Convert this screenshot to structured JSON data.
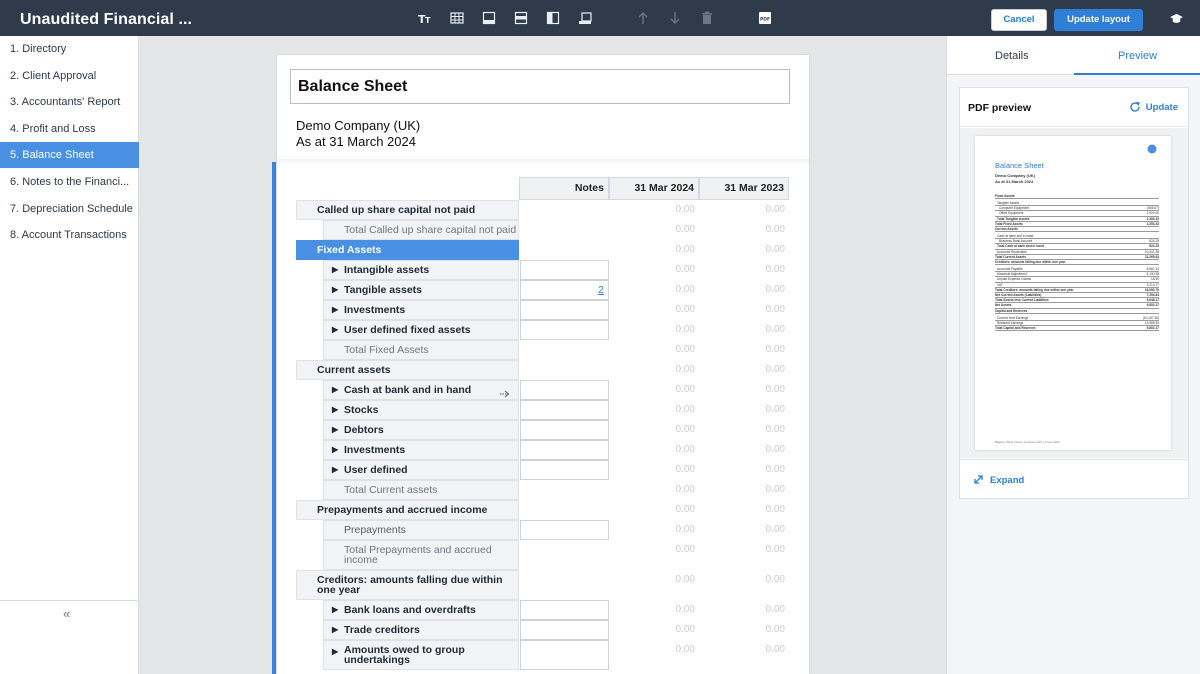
{
  "header": {
    "title": "Unaudited Financial ...",
    "cancel_label": "Cancel",
    "update_label": "Update layout"
  },
  "sidebar": {
    "items": [
      {
        "label": "1. Directory"
      },
      {
        "label": "2. Client Approval"
      },
      {
        "label": "3. Accountants' Report"
      },
      {
        "label": "4. Profit and Loss"
      },
      {
        "label": "5. Balance Sheet",
        "active": true
      },
      {
        "label": "6. Notes to the Financi..."
      },
      {
        "label": "7. Depreciation Schedule"
      },
      {
        "label": "8. Account Transactions"
      }
    ],
    "collapse_glyph": "«"
  },
  "document": {
    "title": "Balance Sheet",
    "company": "Demo Company (UK)",
    "as_at": "As at 31 March 2024",
    "columns": [
      "Notes",
      "31 Mar 2024",
      "31 Mar 2023"
    ],
    "zero": "0.00",
    "rows": [
      {
        "kind": "sec",
        "label": "Called up share capital not paid"
      },
      {
        "kind": "tot",
        "label": "Total Called up share capital not paid"
      },
      {
        "kind": "sec",
        "label": "Fixed Assets",
        "active": true
      },
      {
        "kind": "sub",
        "label": "Intangible assets",
        "notes": true
      },
      {
        "kind": "sub",
        "label": "Tangible assets",
        "notes": true,
        "note": "2"
      },
      {
        "kind": "sub",
        "label": "Investments",
        "notes": true
      },
      {
        "kind": "sub",
        "label": "User defined fixed assets",
        "notes": true
      },
      {
        "kind": "tot",
        "label": "Total Fixed Assets"
      },
      {
        "kind": "sec",
        "label": "Current assets"
      },
      {
        "kind": "sub",
        "label": "Cash at bank and in hand",
        "notes": true,
        "arrow": true
      },
      {
        "kind": "sub",
        "label": "Stocks",
        "notes": true
      },
      {
        "kind": "sub",
        "label": "Debtors",
        "notes": true
      },
      {
        "kind": "sub",
        "label": "Investments",
        "notes": true
      },
      {
        "kind": "sub",
        "label": "User defined",
        "notes": true
      },
      {
        "kind": "tot",
        "label": "Total Current assets"
      },
      {
        "kind": "sec",
        "label": "Prepayments and accrued income"
      },
      {
        "kind": "plain",
        "label": "Prepayments",
        "notes": true
      },
      {
        "kind": "tot2",
        "label": "Total Prepayments and accrued income"
      },
      {
        "kind": "sec2",
        "label": "Creditors: amounts falling due within one year"
      },
      {
        "kind": "sub",
        "label": "Bank loans and overdrafts",
        "notes": true
      },
      {
        "kind": "sub",
        "label": "Trade creditors",
        "notes": true
      },
      {
        "kind": "sub2",
        "label": "Amounts owed to group undertakings",
        "notes": true
      }
    ]
  },
  "right_panel": {
    "tabs": [
      "Details",
      "Preview"
    ],
    "preview_title": "PDF preview",
    "update_label": "Update",
    "expand_label": "Expand",
    "mini_page": {
      "title": "Balance Sheet",
      "company": "Demo Company (UK)",
      "as_at": "As at 31 March 2024",
      "lines": [
        {
          "t": "Fixed Assets",
          "b": true
        },
        {
          "t": "Tangible Assets",
          "b": false,
          "i": 1
        },
        {
          "t": "Computer Equipment",
          "v": "(565.67)",
          "i": 2
        },
        {
          "t": "Office Equipment",
          "v": "2,920.00",
          "i": 2
        },
        {
          "t": "Total Tangible Assets",
          "v": "2,353.33",
          "i": 1,
          "b": true
        },
        {
          "t": "Total Fixed Assets",
          "v": "2,353.33",
          "b": true
        },
        {
          "t": "Current Assets",
          "b": true
        },
        {
          "t": "Cash at bank and in hand",
          "i": 1
        },
        {
          "t": "Business Bank Account",
          "v": "824.25",
          "i": 2
        },
        {
          "t": "Total Cash at bank and in hand",
          "v": "824.25",
          "i": 1,
          "b": true
        },
        {
          "t": "Accounts Receivable",
          "v": "10,441.38",
          "i": 1
        },
        {
          "t": "Total Current Assets",
          "v": "11,265.63",
          "b": true
        },
        {
          "t": "Creditors: amounts falling due within one year",
          "b": true
        },
        {
          "t": "Accounts Payable",
          "v": "8,687.14",
          "i": 1
        },
        {
          "t": "Historical Adjustment",
          "v": "4,130.98",
          "i": 1
        },
        {
          "t": "Unpaid Expense Claims",
          "v": "18.90",
          "i": 1
        },
        {
          "t": "VAT",
          "v": "3,213.77",
          "i": 1
        },
        {
          "t": "Total Creditors: amounts falling due within one year",
          "v": "16,050.79",
          "b": true
        },
        {
          "t": "Net Current Assets (Liabilities)",
          "v": "7,294.84",
          "b": true
        },
        {
          "t": "Total Assets less Current Liabilities",
          "v": "9,648.17",
          "b": true
        },
        {
          "t": "Net Assets",
          "v": "9,802.17",
          "b": true
        },
        {
          "t": "Capital and Reserves",
          "b": true
        },
        {
          "t": "Current Year Earnings",
          "v": "(10,187.35)",
          "i": 1
        },
        {
          "t": "Retained Earnings",
          "v": "19,989.53",
          "i": 1
        },
        {
          "t": "Total Capital and Reserves",
          "v": "9,802.17",
          "b": true
        }
      ],
      "footer": "Balance Sheet   |   Demo Company (UK)   |   23 Apr 2024"
    }
  }
}
